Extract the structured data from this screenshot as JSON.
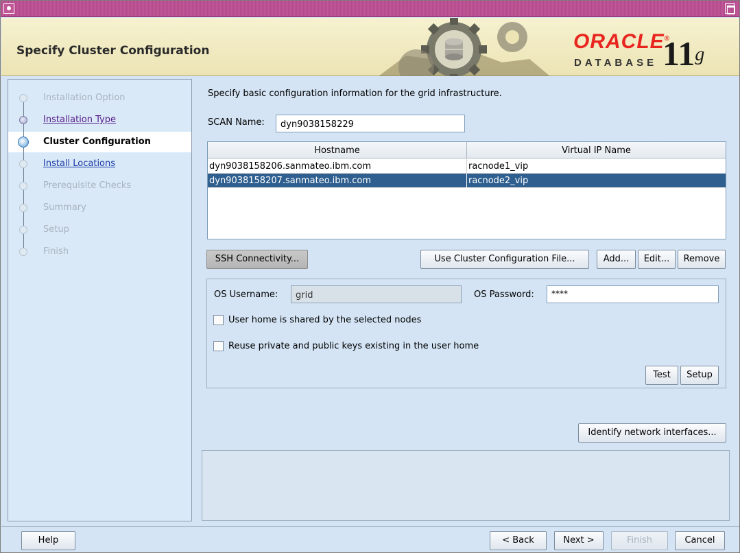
{
  "window": {
    "title": "Specify Cluster Configuration"
  },
  "branding": {
    "logo": "ORACLE",
    "sub": "DATABASE",
    "version": "11",
    "version_sup": "g"
  },
  "steps": [
    {
      "label": "Installation Option",
      "state": "disabled"
    },
    {
      "label": "Installation Type",
      "state": "done"
    },
    {
      "label": "Cluster Configuration",
      "state": "current"
    },
    {
      "label": "Install Locations",
      "state": "link"
    },
    {
      "label": "Prerequisite Checks",
      "state": "disabled"
    },
    {
      "label": "Summary",
      "state": "disabled"
    },
    {
      "label": "Setup",
      "state": "disabled"
    },
    {
      "label": "Finish",
      "state": "disabled"
    }
  ],
  "main": {
    "intro": "Specify basic configuration information for the grid infrastructure.",
    "scan_label": "SCAN Name:",
    "scan_value": "dyn9038158229"
  },
  "grid": {
    "columns": [
      "Hostname",
      "Virtual IP Name"
    ],
    "rows": [
      {
        "hostname": "dyn9038158206.sanmateo.ibm.com",
        "vip": "racnode1_vip",
        "selected": false
      },
      {
        "hostname": "dyn9038158207.sanmateo.ibm.com",
        "vip": "racnode2_vip",
        "selected": true
      }
    ]
  },
  "buttons": {
    "ssh": "SSH Connectivity...",
    "use_file": "Use Cluster Configuration File...",
    "add": "Add...",
    "edit": "Edit...",
    "remove": "Remove",
    "test": "Test",
    "setup": "Setup",
    "identify": "Identify network interfaces...",
    "help": "Help",
    "back": "< Back",
    "next": "Next >",
    "finish": "Finish",
    "cancel": "Cancel"
  },
  "ssh": {
    "user_label": "OS Username:",
    "user_value": "grid",
    "pass_label": "OS Password:",
    "pass_value": "****",
    "shared_label": "User home is shared by the selected nodes",
    "shared_checked": false,
    "reuse_label": "Reuse private and public keys existing in the user home",
    "reuse_checked": false
  }
}
